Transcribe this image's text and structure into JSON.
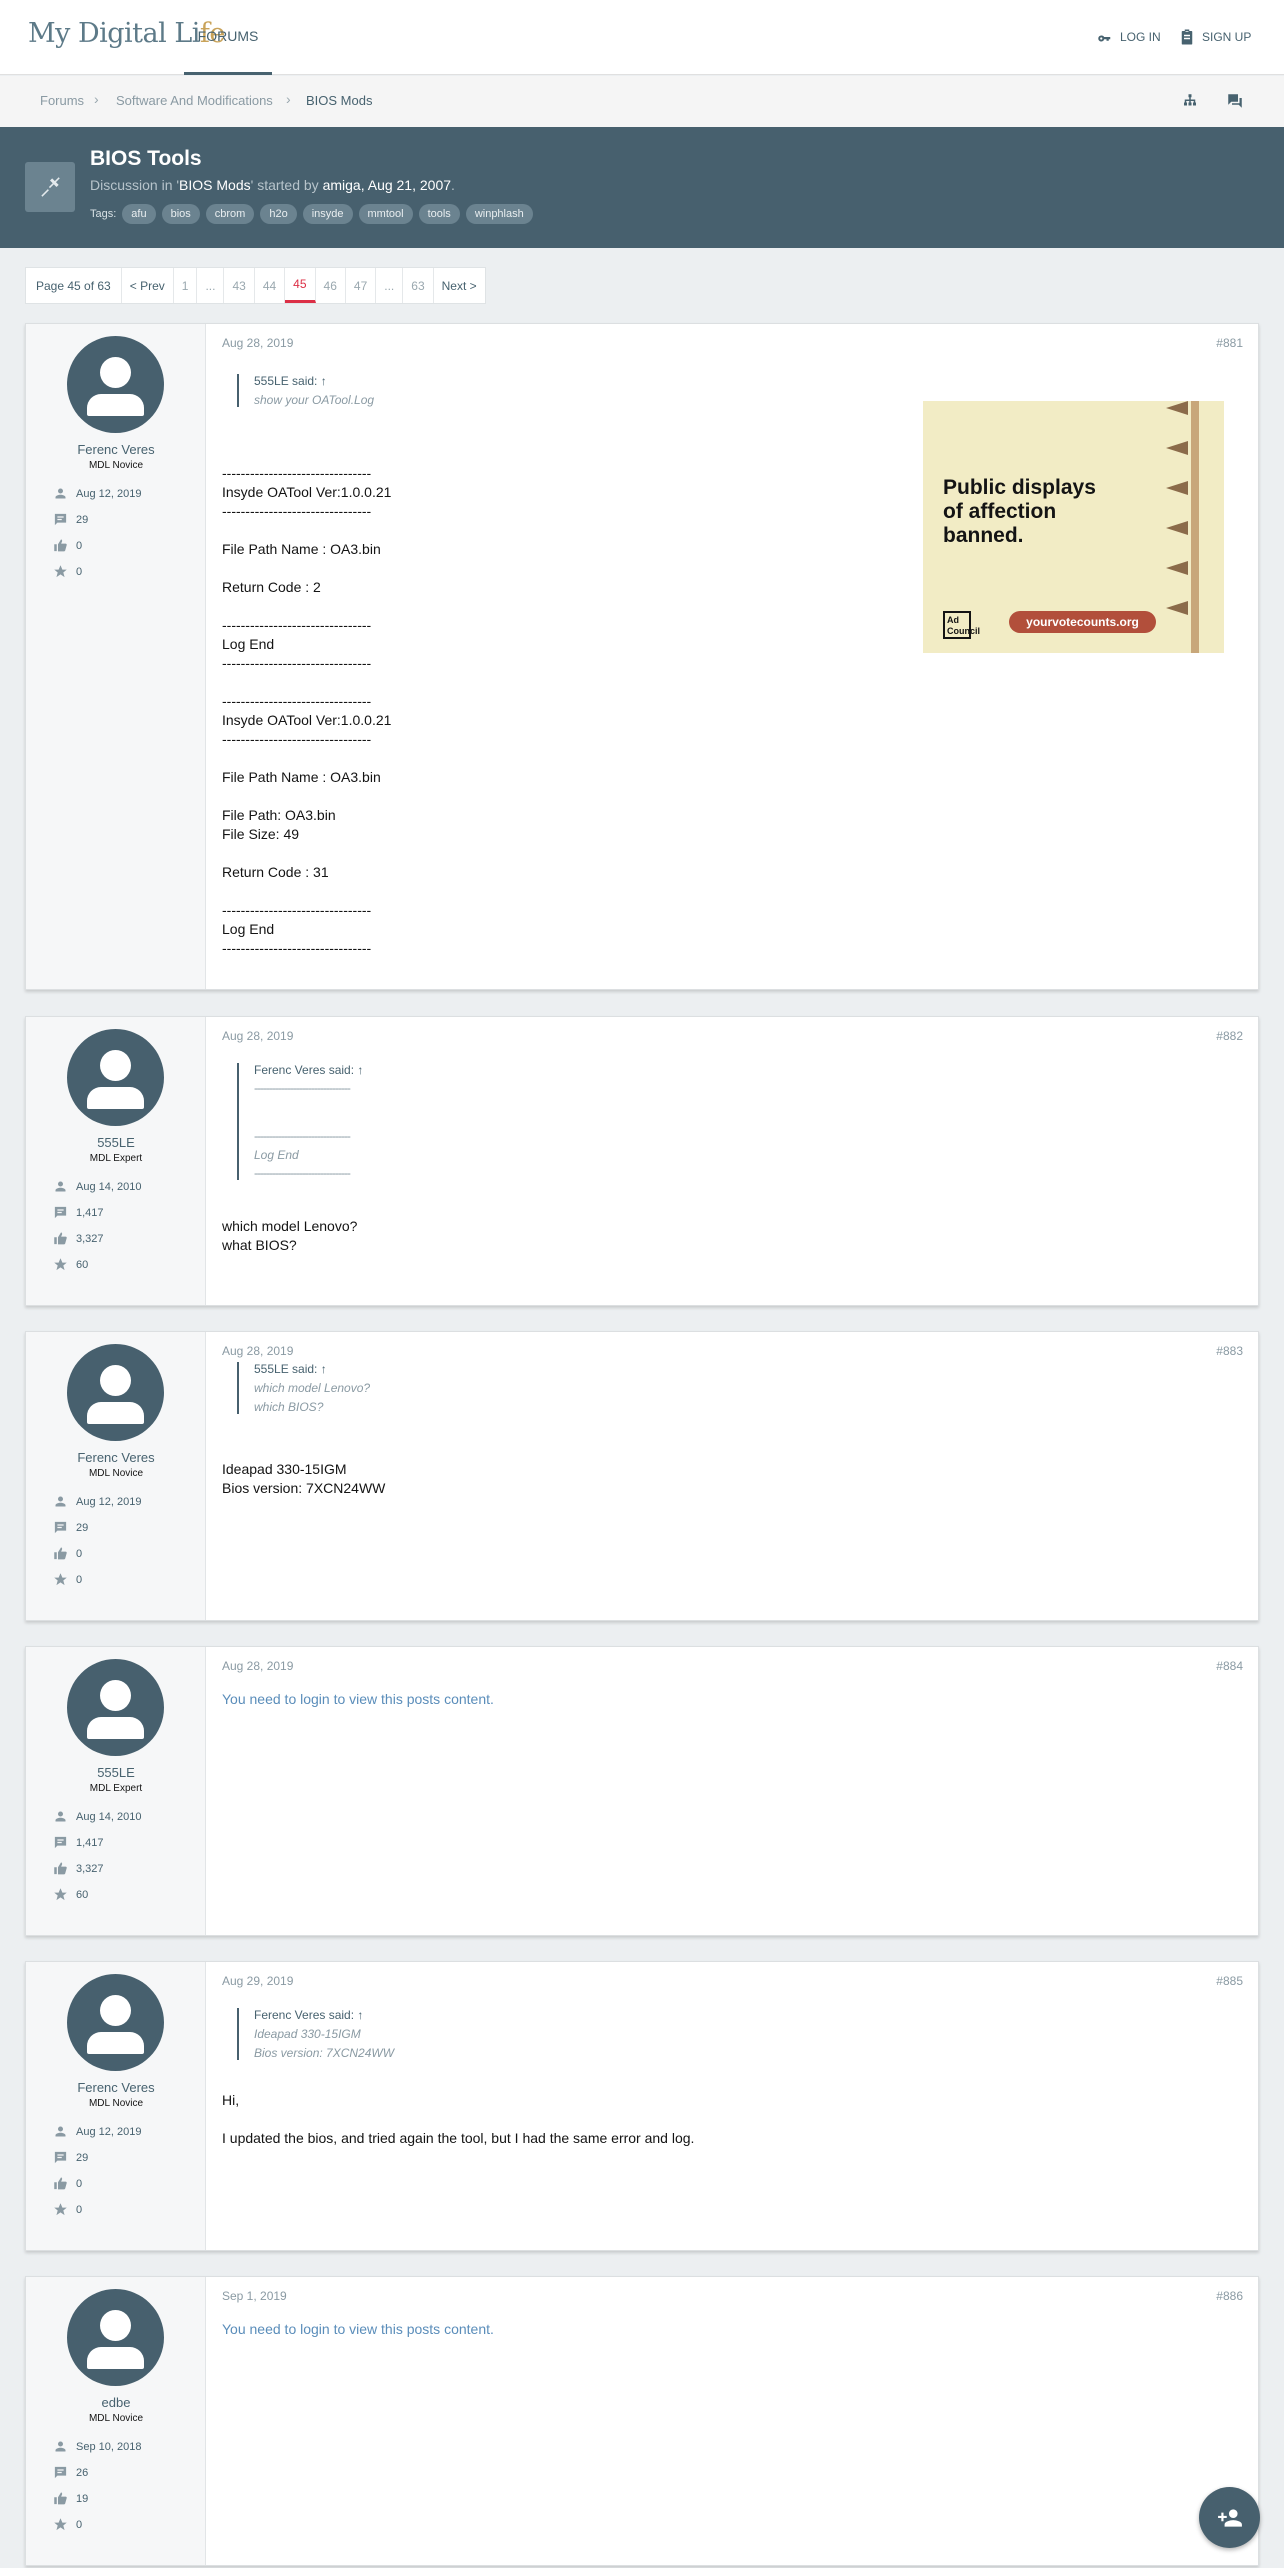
{
  "header": {
    "logo_main": "My Digital Li",
    "logo_accent": "fe",
    "nav_forums": "FORUMS",
    "login": "LOG IN",
    "signup": "SIGN UP"
  },
  "breadcrumb": {
    "items": [
      "Forums",
      "Software And Modifications",
      "BIOS Mods"
    ]
  },
  "thread": {
    "title": "BIOS Tools",
    "sub_prefix": "Discussion in '",
    "forum": "BIOS Mods",
    "sub_mid": "' started by ",
    "author": "amiga",
    "date": ", Aug 21, 2007",
    "tags_label": "Tags:",
    "tags": [
      "afu",
      "bios",
      "cbrom",
      "h2o",
      "insyde",
      "mmtool",
      "tools",
      "winphlash"
    ]
  },
  "pagination": {
    "label": "Page 45 of 63",
    "prev": "< Prev",
    "pages": [
      "1",
      "...",
      "43",
      "44",
      "45",
      "46",
      "47",
      "...",
      "63"
    ],
    "next": "Next >"
  },
  "posts": [
    {
      "user": "Ferenc Veres",
      "title": "MDL Novice",
      "joined": "Aug 12, 2019",
      "messages": "29",
      "likes": "0",
      "points": "0",
      "date": "Aug 28, 2019",
      "num": "#881",
      "quote_author": "555LE said: ↑",
      "quote_lines": [
        "show your OATool.Log"
      ],
      "message": "--------------------------------\nInsyde OATool Ver:1.0.0.21\n--------------------------------\n\nFile Path Name : OA3.bin\n\nReturn Code : 2\n\n--------------------------------\nLog End\n--------------------------------\n\n--------------------------------\nInsyde OATool Ver:1.0.0.21\n--------------------------------\n\nFile Path Name : OA3.bin\n\nFile Path: OA3.bin\nFile Size: 49\n\nReturn Code : 31\n\n--------------------------------\nLog End\n--------------------------------"
    },
    {
      "user": "555LE",
      "title": "MDL Expert",
      "joined": "Aug 14, 2010",
      "messages": "1,417",
      "likes": "3,327",
      "points": "60",
      "date": "Aug 28, 2019",
      "num": "#882",
      "quote_author": "Ferenc Veres said: ↑",
      "quote_lines": [
        "--------------------------------",
        "",
        "--------------------------------",
        "Log End",
        "--------------------------------"
      ],
      "message": "which model Lenovo?\nwhat BIOS?"
    },
    {
      "user": "Ferenc Veres",
      "title": "MDL Novice",
      "joined": "Aug 12, 2019",
      "messages": "29",
      "likes": "0",
      "points": "0",
      "date": "Aug 28, 2019",
      "num": "#883",
      "quote_author": "555LE said: ↑",
      "quote_lines": [
        "which model Lenovo?",
        "which BIOS?"
      ],
      "message": "Ideapad 330-15IGM\nBios version: 7XCN24WW"
    },
    {
      "user": "555LE",
      "title": "MDL Expert",
      "joined": "Aug 14, 2010",
      "messages": "1,417",
      "likes": "3,327",
      "points": "60",
      "date": "Aug 28, 2019",
      "num": "#884",
      "login_msg": "You need to login to view this posts content."
    },
    {
      "user": "Ferenc Veres",
      "title": "MDL Novice",
      "joined": "Aug 12, 2019",
      "messages": "29",
      "likes": "0",
      "points": "0",
      "date": "Aug 29, 2019",
      "num": "#885",
      "quote_author": "Ferenc Veres said: ↑",
      "quote_lines": [
        "Ideapad 330-15IGM",
        "Bios version: 7XCN24WW"
      ],
      "message": "Hi,\n\nI updated the bios, and tried again the tool, but I had the same error and log."
    },
    {
      "user": "edbe",
      "title": "MDL Novice",
      "joined": "Sep 10, 2018",
      "messages": "26",
      "likes": "19",
      "points": "0",
      "date": "Sep 1, 2019",
      "num": "#886",
      "login_msg": "You need to login to view this posts content."
    }
  ],
  "ad": {
    "headline_1": "Public displays",
    "headline_2": "of affection",
    "headline_3": "banned.",
    "url": "yourvotecounts.org",
    "logo": "Ad Council"
  },
  "colors": {
    "primary": "#47606e",
    "accent_red": "#dc2f46",
    "link": "#5a8dba"
  },
  "icons": {
    "login": "key-icon",
    "signup": "clipboard-icon",
    "fab": "add-user-icon"
  }
}
